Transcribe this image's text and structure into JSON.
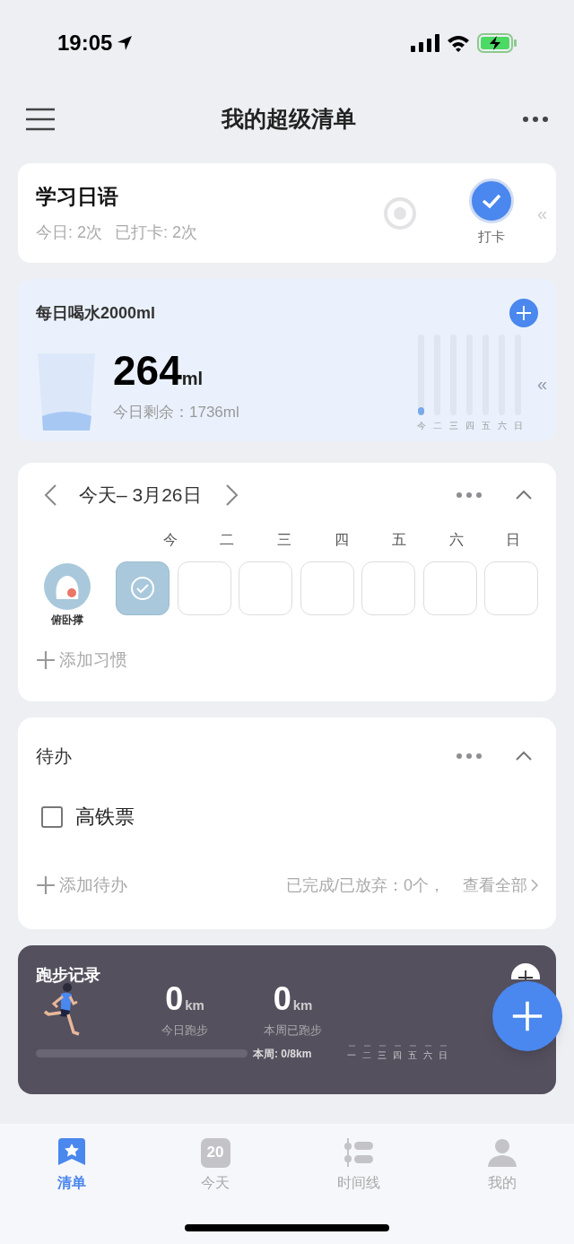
{
  "status_bar": {
    "time": "19:05"
  },
  "header": {
    "title": "我的超级清单"
  },
  "checkin_card": {
    "title": "学习日语",
    "today": "今日: 2次",
    "done": "已打卡: 2次",
    "checked": true,
    "button_label": "打卡",
    "swipe_hint": "«"
  },
  "water_card": {
    "title": "每日喝水2000ml",
    "amount": "264",
    "unit": "ml",
    "remaining": "今日剩余：1736ml",
    "swipe_hint": "«",
    "days": [
      {
        "label": "今",
        "level": 0.1
      },
      {
        "label": "二"
      },
      {
        "label": "三"
      },
      {
        "label": "四"
      },
      {
        "label": "五"
      },
      {
        "label": "六"
      },
      {
        "label": "日"
      }
    ]
  },
  "habit_card": {
    "date": "今天– 3月26日",
    "weekdays": [
      "今",
      "二",
      "三",
      "四",
      "五",
      "六",
      "日"
    ],
    "habits": [
      {
        "name": "俯卧撑",
        "days": [
          {
            "checked": true
          },
          {
            "checked": false
          },
          {
            "checked": false
          },
          {
            "checked": false
          },
          {
            "checked": false
          },
          {
            "checked": false
          },
          {
            "checked": false
          }
        ]
      }
    ],
    "add_label": "添加习惯"
  },
  "todo_card": {
    "title": "待办",
    "items": [
      {
        "label": "高铁票",
        "checked": false
      }
    ],
    "add_label": "添加待办",
    "summary": "已完成/已放弃：0个，",
    "view_all": "查看全部"
  },
  "running_card": {
    "title": "跑步记录",
    "today_value": "0",
    "today_unit": "km",
    "today_label": "今日跑步",
    "week_value": "0",
    "week_unit": "km",
    "week_label": "本周已跑步",
    "progress": {
      "level": 0,
      "label": "本周: 0/8km"
    },
    "days": [
      "一",
      "二",
      "三",
      "四",
      "五",
      "六",
      "日"
    ]
  },
  "tab_bar": [
    {
      "label": "清单",
      "selected": true,
      "kind": "list"
    },
    {
      "label": "今天",
      "selected": false,
      "kind": "today",
      "badge": "20"
    },
    {
      "label": "时间线",
      "selected": false,
      "kind": "timeline"
    },
    {
      "label": "我的",
      "selected": false,
      "kind": "me"
    }
  ]
}
